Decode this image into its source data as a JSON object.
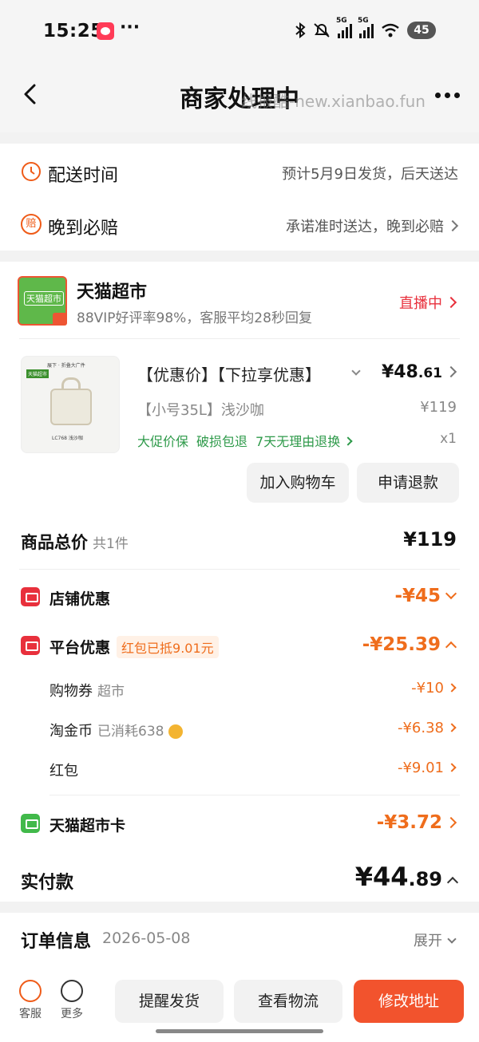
{
  "status_bar": {
    "time": "15:25",
    "dots": "···",
    "sig1_label": "5G",
    "sig2_label": "5G",
    "battery": "45"
  },
  "nav": {
    "title": "商家处理中",
    "watermark": "线报酷-new.xianbao.fun"
  },
  "delivery": {
    "time_icon": "clock-icon",
    "time_label": "配送时间",
    "time_value": "预计5月9日发货，后天送达",
    "late_icon_text": "赔",
    "late_label": "晚到必赔",
    "late_value": "承诺准时送达，晚到必赔"
  },
  "store": {
    "logo_text": "天猫超市",
    "name": "天猫超市",
    "subtitle": "88VIP好评率98%，客服平均28秒回复",
    "live_label": "直播中"
  },
  "product": {
    "image_top_text": "展下 · 折叠大广件",
    "image_tag": "天猫超市",
    "image_caption": "LC768 浅沙咖",
    "title": "【优惠价】【下拉享优惠】",
    "price_int": "¥48",
    "price_dec": ".61",
    "spec": "【小号35L】浅沙咖",
    "orig_price": "¥119",
    "tags": [
      "大促价保",
      "破损包退",
      "7天无理由退换"
    ],
    "qty": "x1",
    "add_cart": "加入购物车",
    "refund": "申请退款"
  },
  "summary": {
    "total_label": "商品总价",
    "total_count": "共1件",
    "total_amount": "¥119",
    "store_discount_label": "店铺优惠",
    "store_discount_amount": "-¥45",
    "platform_label": "平台优惠",
    "platform_badge": "红包已抵9.01元",
    "platform_amount": "-¥25.39",
    "coupon_label": "购物券",
    "coupon_sub": "超市",
    "coupon_amount": "-¥10",
    "coin_label": "淘金币",
    "coin_sub": "已消耗638",
    "coin_amount": "-¥6.38",
    "redpacket_label": "红包",
    "redpacket_amount": "-¥9.01",
    "card_label": "天猫超市卡",
    "card_amount": "-¥3.72",
    "paid_label": "实付款",
    "paid_int": "¥44",
    "paid_dec": ".89"
  },
  "order_info": {
    "label": "订单信息",
    "date": "2026-05-08",
    "expand": "展开"
  },
  "bottom": {
    "service_label": "客服",
    "more_label": "更多",
    "remind": "提醒发货",
    "logistics": "查看物流",
    "modify_address": "修改地址"
  },
  "colors": {
    "accent": "#ef6d1c",
    "primary_button": "#f2532d",
    "live_red": "#e8303c",
    "tag_green": "#2e9a4a"
  }
}
